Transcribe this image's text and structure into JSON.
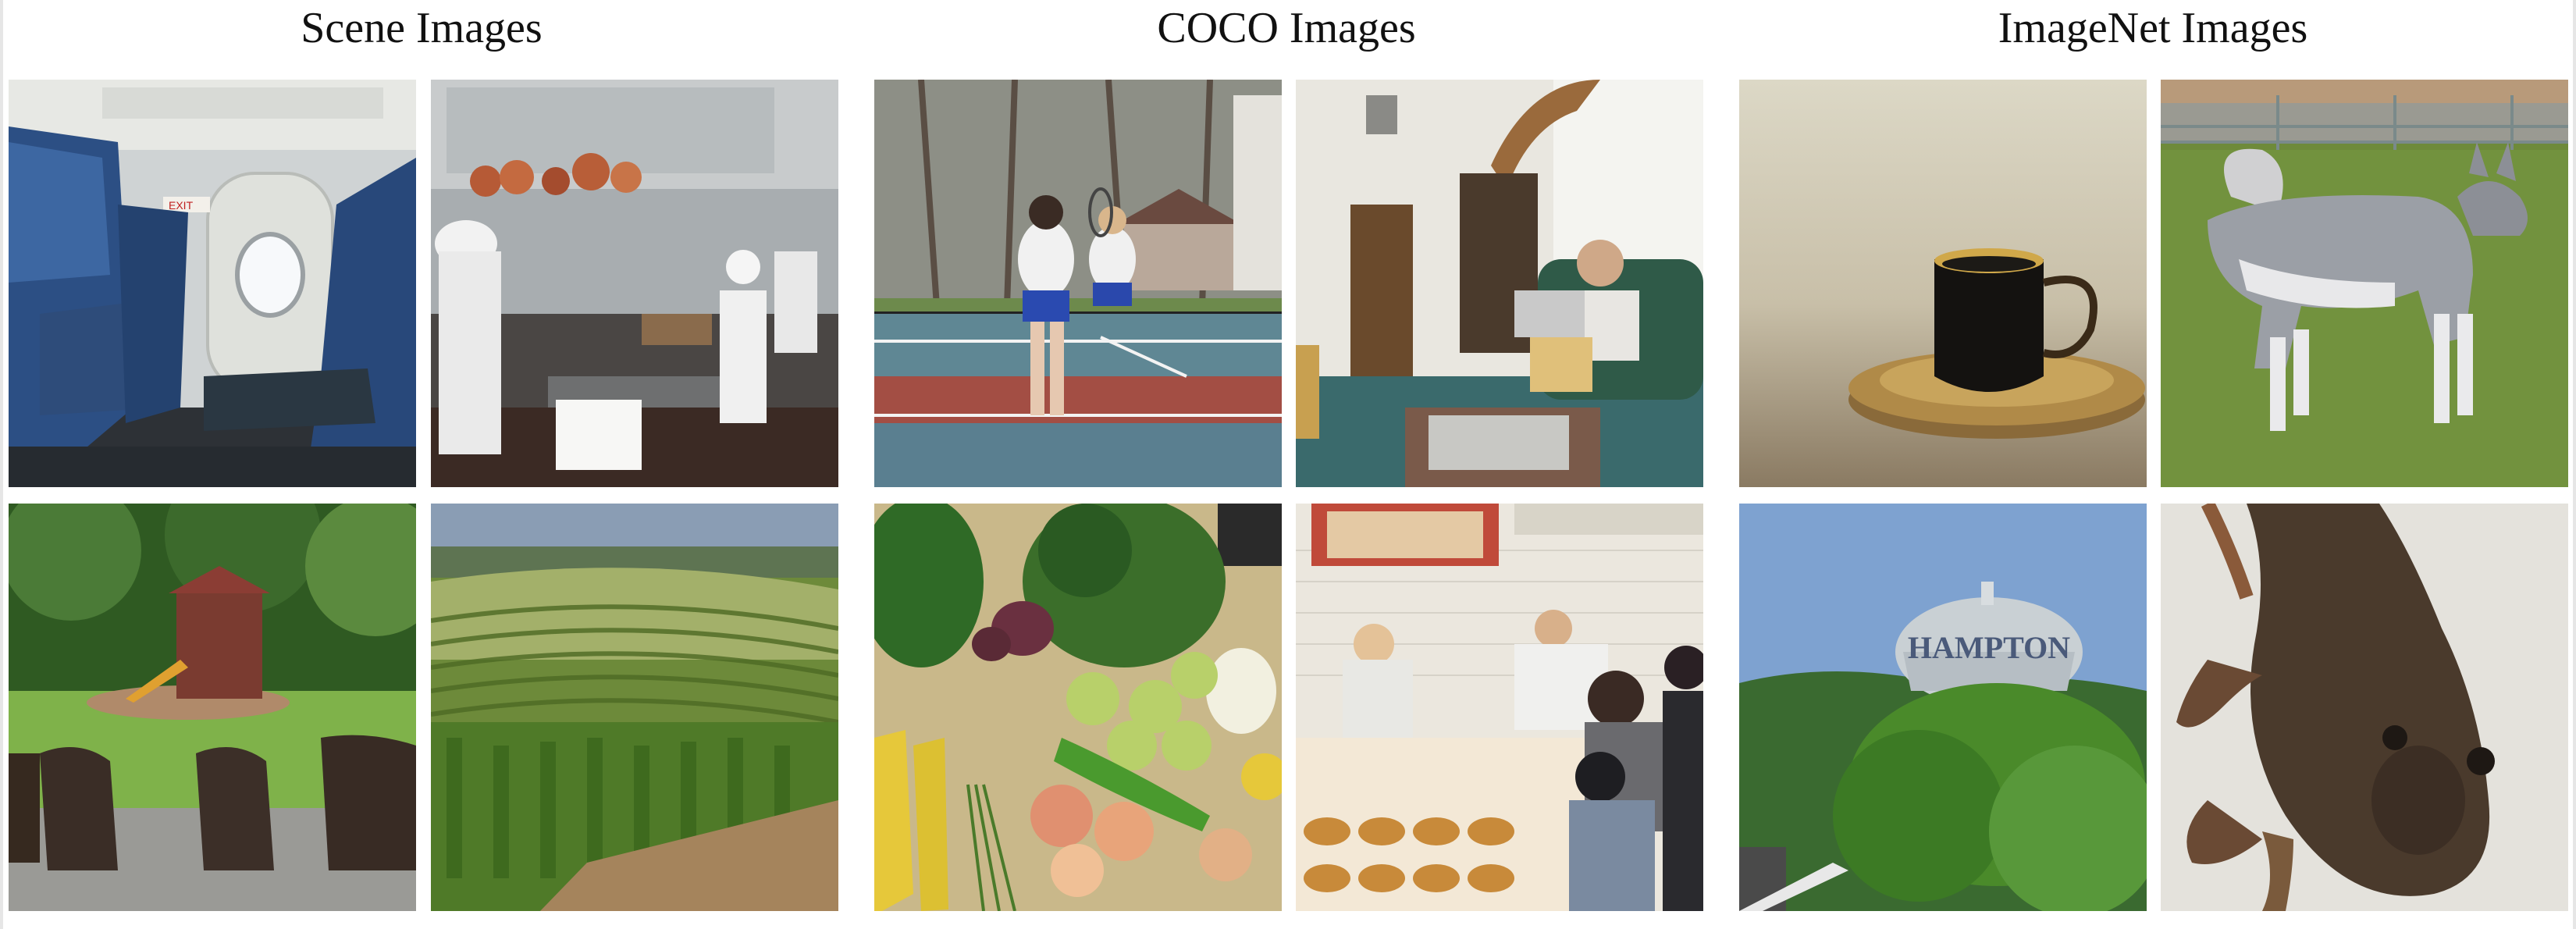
{
  "headings": {
    "scene": "Scene Images",
    "coco": "COCO Images",
    "imagenet": "ImageNet Images"
  },
  "photos": {
    "scene": [
      "airplane cabin interior",
      "commercial kitchen",
      "backyard with playset",
      "vineyard hills"
    ],
    "coco": [
      "tennis players",
      "living room with person",
      "vegetables and fruit",
      "bakery counter"
    ],
    "imagenet": [
      "coffee cup on saucer",
      "husky dog",
      "water tower",
      "frog"
    ]
  },
  "text_in_photos": {
    "exit_sign": "EXIT",
    "water_tower": "HAMPTON"
  }
}
